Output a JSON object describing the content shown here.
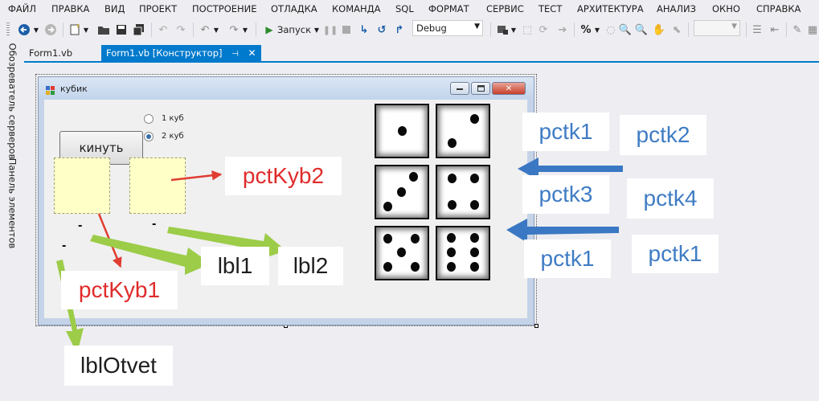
{
  "menu": {
    "items": [
      "ФАЙЛ",
      "ПРАВКА",
      "ВИД",
      "ПРОЕКТ",
      "ПОСТРОЕНИЕ",
      "ОТЛАДКА",
      "КОМАНДА",
      "SQL",
      "ФОРМАТ",
      "СЕРВИС",
      "ТЕСТ",
      "АРХИТЕКТУРА",
      "АНАЛИЗ",
      "ОКНО",
      "СПРАВКА"
    ]
  },
  "toolbar": {
    "run_label": "Запуск",
    "config_value": "Debug"
  },
  "side_panel": {
    "server_explorer": "Обозреватель серверов",
    "toolbox": "Панель элементов"
  },
  "tabs": {
    "code": "Form1.vb",
    "designer": "Form1.vb [Конструктор]"
  },
  "form": {
    "title": "кубик",
    "button_label": "кинуть",
    "radio1": "1 куб",
    "radio2": "2 куб",
    "lbl1_text": "-",
    "lbl2_text": "-",
    "lblotvet_text": "-"
  },
  "annotations": {
    "pctKyb2": "pctKyb2",
    "pctKyb1": "pctKyb1",
    "lbl1": "lbl1",
    "lbl2": "lbl2",
    "lblOtvet": "lblOtvet",
    "pctk1_a": "pctk1",
    "pctk2": "pctk2",
    "pctk3": "pctk3",
    "pctk4": "pctk4",
    "pctk1_b": "pctk1",
    "pctk1_c": "pctk1"
  },
  "colors": {
    "accent": "#007acc",
    "red_note": "#e02b2b",
    "blue_note": "#3f7cc4",
    "green_arrow": "#9ccc48",
    "red_arrow": "#e03c31",
    "blue_arrow": "#3b78c3"
  },
  "dice_faces": [
    1,
    2,
    3,
    4,
    5,
    6
  ]
}
